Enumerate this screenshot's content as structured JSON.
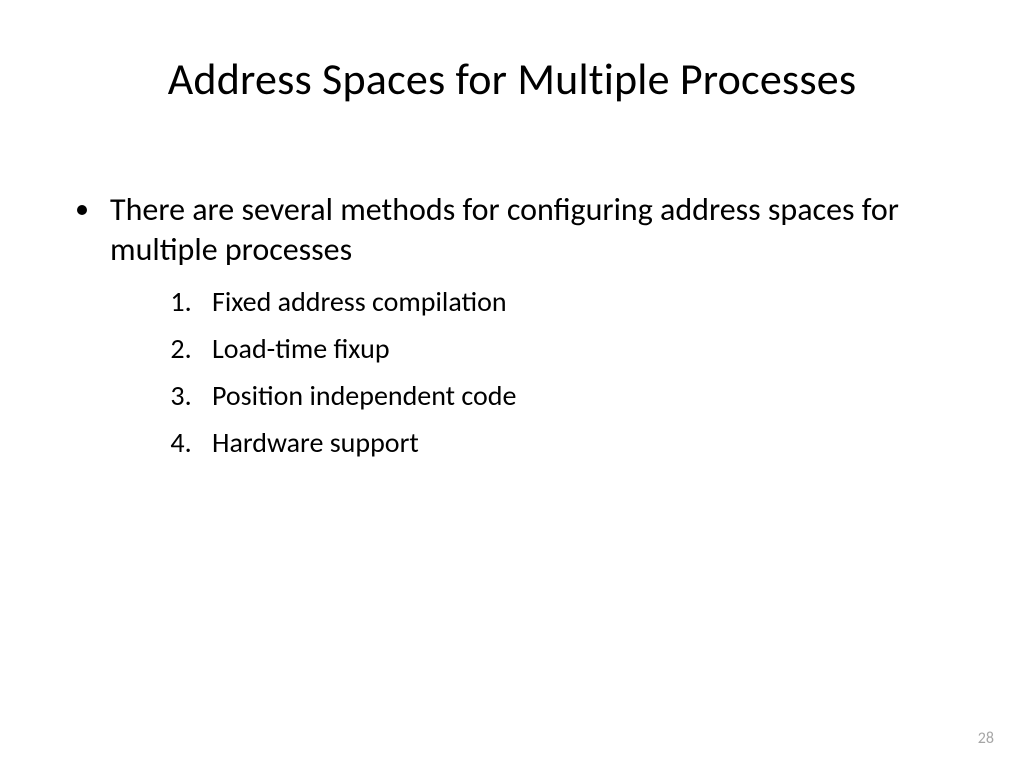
{
  "slide": {
    "title": "Address Spaces for Multiple Processes",
    "bullets": [
      {
        "text": "There are several methods for configuring address spaces for multiple processes",
        "sub": [
          "Fixed address compilation",
          "Load-time fixup",
          "Position independent code",
          "Hardware support"
        ]
      }
    ],
    "page_number": "28"
  }
}
